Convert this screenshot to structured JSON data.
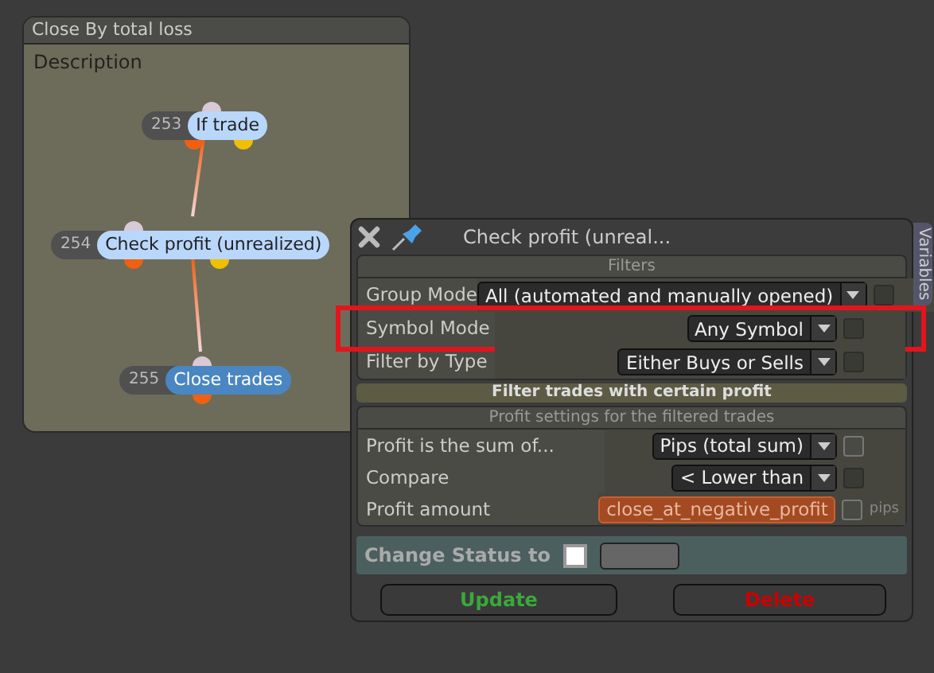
{
  "panel": {
    "title": "Close By total loss",
    "description": "Description",
    "nodes": [
      {
        "number": "253",
        "label": "If trade",
        "selected": false
      },
      {
        "number": "254",
        "label": "Check profit (unrealized)",
        "selected": false
      },
      {
        "number": "255",
        "label": "Close trades",
        "selected": true
      }
    ]
  },
  "dialog": {
    "title": "Check profit (unreal...",
    "filters": {
      "header": "Filters",
      "rows": [
        {
          "label": "Group Mode",
          "value": "All (automated and manually opened)",
          "kind": "dropdown",
          "highlighted": false,
          "checkbox": {
            "checked": false,
            "disabled": true
          }
        },
        {
          "label": "Symbol Mode",
          "value": "Any Symbol",
          "kind": "dropdown",
          "highlighted": true,
          "checkbox": {
            "checked": false,
            "disabled": true
          }
        },
        {
          "label": "Filter by Type",
          "value": "Either Buys or Sells",
          "kind": "dropdown",
          "highlighted": false,
          "checkbox": {
            "checked": false,
            "disabled": true
          }
        }
      ]
    },
    "group_header": "Filter trades with certain profit",
    "profit": {
      "header": "Profit settings for the filtered trades",
      "rows": [
        {
          "label": "Profit is the sum of...",
          "value": "Pips (total sum)",
          "kind": "dropdown",
          "highlighted": false,
          "checkbox": {
            "checked": false,
            "disabled": false
          }
        },
        {
          "label": "Compare",
          "value": "< Lower than",
          "kind": "dropdown",
          "highlighted": false,
          "checkbox": {
            "checked": false,
            "disabled": true
          }
        },
        {
          "label": "Profit amount",
          "value": "close_at_negative_profit",
          "kind": "variable",
          "highlighted": false,
          "checkbox": {
            "checked": false,
            "disabled": false
          },
          "unit": "pips"
        }
      ]
    },
    "status": {
      "label": "Change Status to",
      "checked": false
    },
    "buttons": [
      {
        "label": "Update",
        "kind": "update"
      },
      {
        "label": "Delete",
        "kind": "delete"
      }
    ]
  },
  "side_tab": "Variables"
}
